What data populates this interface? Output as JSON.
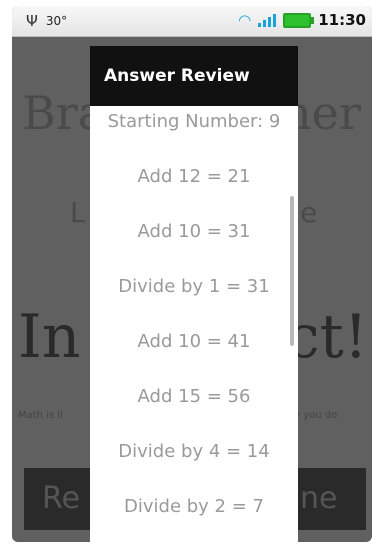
{
  "status_bar": {
    "temperature": "30°",
    "time": "11:30",
    "icons": [
      "usb-icon",
      "wifi-icon",
      "signal-icon",
      "battery-icon"
    ]
  },
  "background_app": {
    "title_left": "Bra",
    "title_right": "ner",
    "level_left": "L",
    "level_right": "e",
    "result_left": "In",
    "result_right": "ct!",
    "sub_left": "Math is li",
    "sub_right": "re you do",
    "button_left": "Re",
    "button_right": "ne"
  },
  "dialog": {
    "title": "Answer Review",
    "steps": [
      "Starting Number: 9",
      "Add 12 = 21",
      "Add 10 = 31",
      "Divide by 1 = 31",
      "Add 10 = 41",
      "Add 15 = 56",
      "Divide by 4 = 14",
      "Divide by 2 = 7"
    ]
  }
}
